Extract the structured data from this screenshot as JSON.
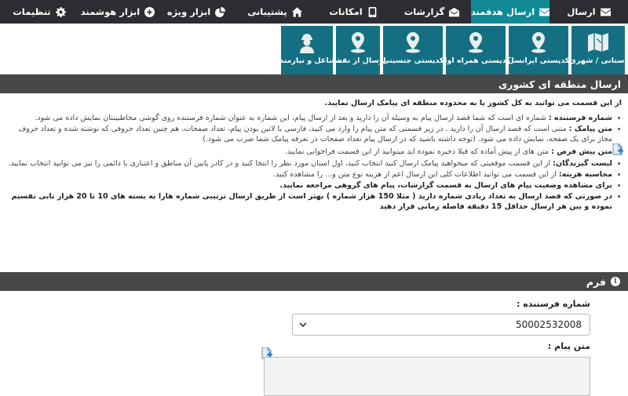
{
  "nav": {
    "tabs": [
      {
        "label": "ارسال",
        "icon": "envelope-icon",
        "active": false
      },
      {
        "label": "ارسال هدفمند",
        "icon": "envelope-icon",
        "active": true
      },
      {
        "label": "گزارشات",
        "icon": "open-envelope-icon",
        "active": false
      },
      {
        "label": "امکانات",
        "icon": "tablet-icon",
        "active": false
      },
      {
        "label": "پشتیبانی",
        "icon": "home-icon",
        "active": false
      },
      {
        "label": "ابزار ویژه",
        "icon": "pie-chart-icon",
        "active": false
      },
      {
        "label": "ابزار هوشمند",
        "icon": "plus-circle-icon",
        "active": false
      },
      {
        "label": "تنظیمات",
        "icon": "gear-icon",
        "active": false
      }
    ]
  },
  "subnav": {
    "tiles": [
      {
        "label": "استانی / شهری",
        "icon": "map-icon"
      },
      {
        "label": "کدپستی ایرانسل",
        "icon": "map-pin-icon"
      },
      {
        "label": "کدپستی همراه اول",
        "icon": "map-pin-icon"
      },
      {
        "label": "کدپستی جنسیتی",
        "icon": "map-pin-icon"
      },
      {
        "label": "ارسال از نقشه",
        "icon": "map-pin-icon"
      },
      {
        "label": "مشاغل و نیازمندی",
        "icon": "worker-icon"
      }
    ]
  },
  "section": {
    "title": "ارسال منطقه ای کشوری",
    "intro": "از این قسمت می توانید به کل کشور یا به محدوده منطقه ای پیامک ارسال نمایید.",
    "bullets1": [
      {
        "term": "شماره فرستنده :",
        "text": " شماره ای است که شما قصد ارسال پیام به وسیله آن را دارید و بعد از ارسال پیام، این شماره به عنوان شماره فرستنده روی گوشی مخاطبینتان نمایش داده می شود."
      },
      {
        "term": "متن پیامک :",
        "text": " متنی است که قصد ارسال آن را دارید . در زیر قسمتی که متن پیام را وارد می کنید، فارسی یا لاتین بودن پیام، تعداد صفحات، هم چنین تعداد حروفی که نوشته شده و تعداد حروف مجاز برای یک صفحه، نمایش داده می شود. (توجه داشته باشید که در ارسال پیام تعداد صفحات در تعرفه پیامک شما ضرب می شود.)"
      }
    ],
    "default_term": "متن پیش فرض :",
    "default_text": " متن های از پیش آماده که قبلا ذخیره نموده اید میتوانید از این قسمت فراخوانی نمایید.",
    "bullets2": [
      {
        "term": "لیست گیرندگان:",
        "text": " از این قسمت موقعیتی که میخواهید پیامک ارسال کنید انتخاب کنید، اول استان مورد نظر را انتخا کنید و در کادر پایین آن مناطق و اعتباری یا دائمی را نیز می توانید انتخاب نمایید."
      },
      {
        "term": "محاسبه هزینه:",
        "text": " از این قسمت می توانید اطلاعات کلی این ارسال اعم از هزینه نوع متن و... را مشاهده کنید."
      }
    ],
    "bold_lines": [
      "برای مشاهده وضعیت پیام های ارسال به قسمت گزارشات، پیام های گروهی مراجعه نمایید.",
      "در صورتی که قصد ارسال به تعداد زیادی شماره دارید ( مثلا 150 هزار شماره ) بهتر است از طریق ارسال ترتیبی شماره هارا به بسته های 10 تا 20 هزار تابی تقسیم نموده و بین هر ارسال حداقل 15 دقیقه فاصله زمانی قرار دهید"
    ]
  },
  "form": {
    "title": "فرم",
    "sender_label": "شماره فرستنده :",
    "sender_value": "50002532008",
    "message_label": "متن پیام :"
  },
  "colors": {
    "topbar": "#2b2d32",
    "accent": "#118a96",
    "tile": "#146f82",
    "section_bar": "#474747"
  }
}
